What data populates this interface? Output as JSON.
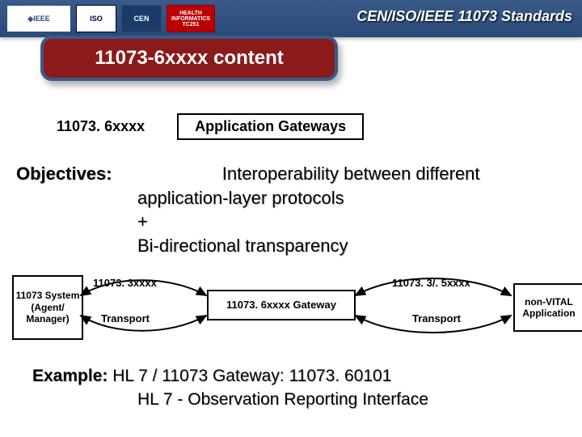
{
  "header": {
    "title": "CEN/ISO/IEEE 11073 Standards",
    "logos": {
      "ieee": "◈IEEE",
      "iso": "ISO",
      "cen": "CEN",
      "health": "HEALTH INFORMATICS TC251"
    }
  },
  "pill_title": "11073-6xxxx content",
  "definition": {
    "code": "11073. 6xxxx",
    "label": "Application Gateways"
  },
  "objectives": {
    "label": "Objectives:",
    "line1": "Interoperability between different",
    "line2": "application-layer protocols",
    "line3": "+",
    "line4": "Bi-directional transparency"
  },
  "diagram": {
    "left_box": "11073 System (Agent/ Manager)",
    "gateway_box": "11073. 6xxxx Gateway",
    "right_box": "non-VITAL Application",
    "left_proto": "11073. 3xxxx",
    "left_transport": "Transport",
    "right_proto": "11073. 3/. 5xxxx",
    "right_transport": "Transport"
  },
  "example": {
    "label": "Example:",
    "line1": "HL 7 / 11073 Gateway: 11073. 60101",
    "line2": "HL 7 - Observation Reporting Interface"
  }
}
